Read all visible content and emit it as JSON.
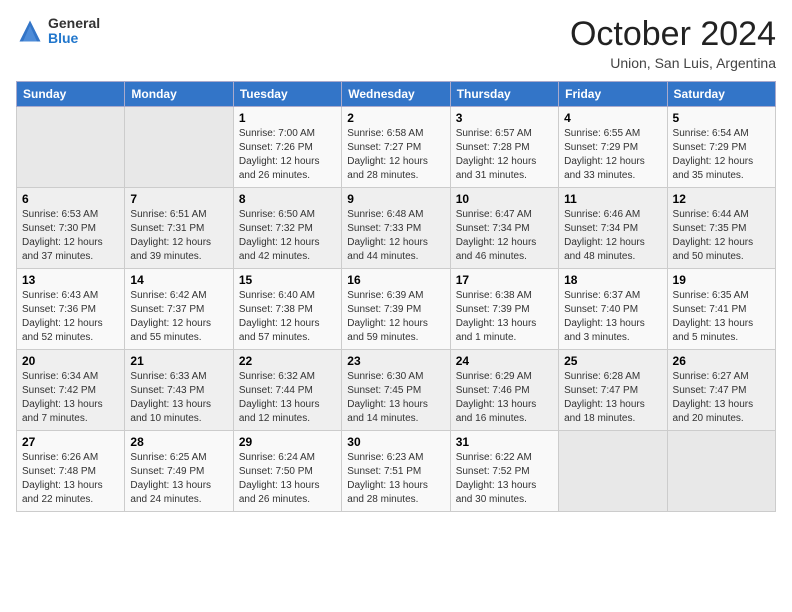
{
  "logo": {
    "general": "General",
    "blue": "Blue"
  },
  "title": "October 2024",
  "location": "Union, San Luis, Argentina",
  "days_header": [
    "Sunday",
    "Monday",
    "Tuesday",
    "Wednesday",
    "Thursday",
    "Friday",
    "Saturday"
  ],
  "weeks": [
    [
      {
        "day": "",
        "info": ""
      },
      {
        "day": "",
        "info": ""
      },
      {
        "day": "1",
        "info": "Sunrise: 7:00 AM\nSunset: 7:26 PM\nDaylight: 12 hours\nand 26 minutes."
      },
      {
        "day": "2",
        "info": "Sunrise: 6:58 AM\nSunset: 7:27 PM\nDaylight: 12 hours\nand 28 minutes."
      },
      {
        "day": "3",
        "info": "Sunrise: 6:57 AM\nSunset: 7:28 PM\nDaylight: 12 hours\nand 31 minutes."
      },
      {
        "day": "4",
        "info": "Sunrise: 6:55 AM\nSunset: 7:29 PM\nDaylight: 12 hours\nand 33 minutes."
      },
      {
        "day": "5",
        "info": "Sunrise: 6:54 AM\nSunset: 7:29 PM\nDaylight: 12 hours\nand 35 minutes."
      }
    ],
    [
      {
        "day": "6",
        "info": "Sunrise: 6:53 AM\nSunset: 7:30 PM\nDaylight: 12 hours\nand 37 minutes."
      },
      {
        "day": "7",
        "info": "Sunrise: 6:51 AM\nSunset: 7:31 PM\nDaylight: 12 hours\nand 39 minutes."
      },
      {
        "day": "8",
        "info": "Sunrise: 6:50 AM\nSunset: 7:32 PM\nDaylight: 12 hours\nand 42 minutes."
      },
      {
        "day": "9",
        "info": "Sunrise: 6:48 AM\nSunset: 7:33 PM\nDaylight: 12 hours\nand 44 minutes."
      },
      {
        "day": "10",
        "info": "Sunrise: 6:47 AM\nSunset: 7:34 PM\nDaylight: 12 hours\nand 46 minutes."
      },
      {
        "day": "11",
        "info": "Sunrise: 6:46 AM\nSunset: 7:34 PM\nDaylight: 12 hours\nand 48 minutes."
      },
      {
        "day": "12",
        "info": "Sunrise: 6:44 AM\nSunset: 7:35 PM\nDaylight: 12 hours\nand 50 minutes."
      }
    ],
    [
      {
        "day": "13",
        "info": "Sunrise: 6:43 AM\nSunset: 7:36 PM\nDaylight: 12 hours\nand 52 minutes."
      },
      {
        "day": "14",
        "info": "Sunrise: 6:42 AM\nSunset: 7:37 PM\nDaylight: 12 hours\nand 55 minutes."
      },
      {
        "day": "15",
        "info": "Sunrise: 6:40 AM\nSunset: 7:38 PM\nDaylight: 12 hours\nand 57 minutes."
      },
      {
        "day": "16",
        "info": "Sunrise: 6:39 AM\nSunset: 7:39 PM\nDaylight: 12 hours\nand 59 minutes."
      },
      {
        "day": "17",
        "info": "Sunrise: 6:38 AM\nSunset: 7:39 PM\nDaylight: 13 hours\nand 1 minute."
      },
      {
        "day": "18",
        "info": "Sunrise: 6:37 AM\nSunset: 7:40 PM\nDaylight: 13 hours\nand 3 minutes."
      },
      {
        "day": "19",
        "info": "Sunrise: 6:35 AM\nSunset: 7:41 PM\nDaylight: 13 hours\nand 5 minutes."
      }
    ],
    [
      {
        "day": "20",
        "info": "Sunrise: 6:34 AM\nSunset: 7:42 PM\nDaylight: 13 hours\nand 7 minutes."
      },
      {
        "day": "21",
        "info": "Sunrise: 6:33 AM\nSunset: 7:43 PM\nDaylight: 13 hours\nand 10 minutes."
      },
      {
        "day": "22",
        "info": "Sunrise: 6:32 AM\nSunset: 7:44 PM\nDaylight: 13 hours\nand 12 minutes."
      },
      {
        "day": "23",
        "info": "Sunrise: 6:30 AM\nSunset: 7:45 PM\nDaylight: 13 hours\nand 14 minutes."
      },
      {
        "day": "24",
        "info": "Sunrise: 6:29 AM\nSunset: 7:46 PM\nDaylight: 13 hours\nand 16 minutes."
      },
      {
        "day": "25",
        "info": "Sunrise: 6:28 AM\nSunset: 7:47 PM\nDaylight: 13 hours\nand 18 minutes."
      },
      {
        "day": "26",
        "info": "Sunrise: 6:27 AM\nSunset: 7:47 PM\nDaylight: 13 hours\nand 20 minutes."
      }
    ],
    [
      {
        "day": "27",
        "info": "Sunrise: 6:26 AM\nSunset: 7:48 PM\nDaylight: 13 hours\nand 22 minutes."
      },
      {
        "day": "28",
        "info": "Sunrise: 6:25 AM\nSunset: 7:49 PM\nDaylight: 13 hours\nand 24 minutes."
      },
      {
        "day": "29",
        "info": "Sunrise: 6:24 AM\nSunset: 7:50 PM\nDaylight: 13 hours\nand 26 minutes."
      },
      {
        "day": "30",
        "info": "Sunrise: 6:23 AM\nSunset: 7:51 PM\nDaylight: 13 hours\nand 28 minutes."
      },
      {
        "day": "31",
        "info": "Sunrise: 6:22 AM\nSunset: 7:52 PM\nDaylight: 13 hours\nand 30 minutes."
      },
      {
        "day": "",
        "info": ""
      },
      {
        "day": "",
        "info": ""
      }
    ]
  ]
}
